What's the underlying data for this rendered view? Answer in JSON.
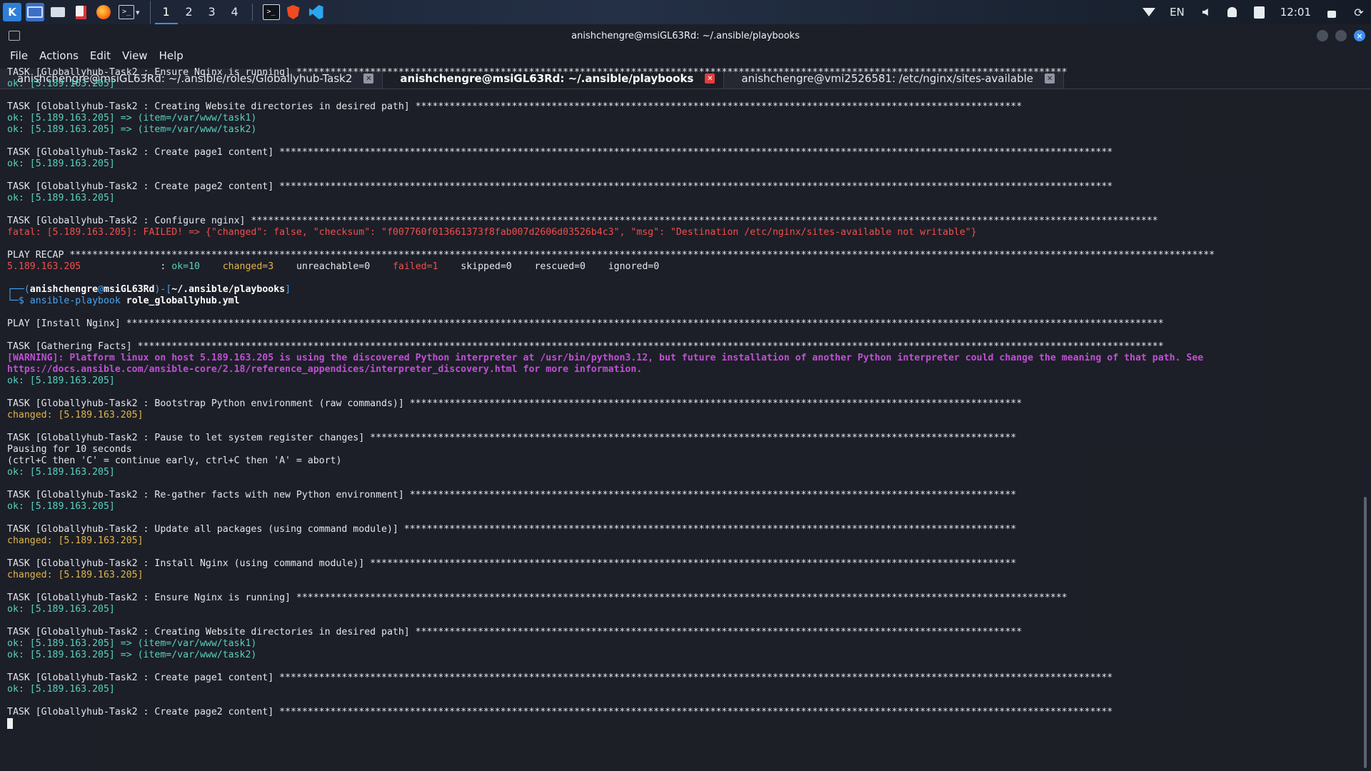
{
  "panel": {
    "launcher_label": "K",
    "term_icon_label": ">_",
    "workspaces": [
      "1",
      "2",
      "3",
      "4"
    ],
    "active_workspace": "1",
    "language": "EN",
    "clock": "12:01"
  },
  "window": {
    "title": "anishchengre@msiGL63Rd: ~/.ansible/playbooks",
    "close_glyph": "×"
  },
  "menu": [
    "File",
    "Actions",
    "Edit",
    "View",
    "Help"
  ],
  "tabs": [
    {
      "label": "anishchengre@msiGL63Rd: ~/.ansible/roles/Globallyhub-Task2",
      "active": false
    },
    {
      "label": "anishchengre@msiGL63Rd: ~/.ansible/playbooks",
      "active": true
    },
    {
      "label": "anishchengre@vmi2526581: /etc/nginx/sites-available",
      "active": false
    }
  ],
  "terminal": {
    "lines": [
      {
        "type": "task",
        "text": "TASK [Globallyhub-Task2 : Ensure Nginx is running] ****************************************************************************************************************************************"
      },
      {
        "type": "ok",
        "text": "ok: [5.189.163.205]"
      },
      {
        "type": "blank",
        "text": ""
      },
      {
        "type": "task",
        "text": "TASK [Globallyhub-Task2 : Creating Website directories in desired path] ***********************************************************************************************************"
      },
      {
        "type": "ok",
        "text": "ok: [5.189.163.205] => (item=/var/www/task1)"
      },
      {
        "type": "ok",
        "text": "ok: [5.189.163.205] => (item=/var/www/task2)"
      },
      {
        "type": "blank",
        "text": ""
      },
      {
        "type": "task",
        "text": "TASK [Globallyhub-Task2 : Create page1 content] ***************************************************************************************************************************************************"
      },
      {
        "type": "ok",
        "text": "ok: [5.189.163.205]"
      },
      {
        "type": "blank",
        "text": ""
      },
      {
        "type": "task",
        "text": "TASK [Globallyhub-Task2 : Create page2 content] ***************************************************************************************************************************************************"
      },
      {
        "type": "ok",
        "text": "ok: [5.189.163.205]"
      },
      {
        "type": "blank",
        "text": ""
      },
      {
        "type": "task",
        "text": "TASK [Globallyhub-Task2 : Configure nginx] ****************************************************************************************************************************************************************"
      },
      {
        "type": "fatal",
        "text": "fatal: [5.189.163.205]: FAILED! => {\"changed\": false, \"checksum\": \"f007760f013661373f8fab007d2606d03526b4c3\", \"msg\": \"Destination /etc/nginx/sites-available not writable\"}"
      },
      {
        "type": "blank",
        "text": ""
      },
      {
        "type": "task",
        "text": "PLAY RECAP **********************************************************************************************************************************************************************************************************"
      },
      {
        "type": "recap",
        "host": "5.189.163.205",
        "pad": "              : ",
        "ok": "ok=10",
        "changed": "changed=3",
        "unreachable": "unreachable=0",
        "failed": "failed=1",
        "skipped": "skipped=0",
        "rescued": "rescued=0",
        "ignored": "ignored=0"
      },
      {
        "type": "blank",
        "text": ""
      },
      {
        "type": "prompt1",
        "user": "anishchengre",
        "at": "@",
        "host": "msiGL63Rd",
        "path": "~/.ansible/playbooks"
      },
      {
        "type": "prompt2",
        "cmd": "ansible-playbook",
        "arg": "role_globallyhub.yml"
      },
      {
        "type": "blank",
        "text": ""
      },
      {
        "type": "task",
        "text": "PLAY [Install Nginx] ***************************************************************************************************************************************************************************************"
      },
      {
        "type": "blank",
        "text": ""
      },
      {
        "type": "task",
        "text": "TASK [Gathering Facts] *************************************************************************************************************************************************************************************"
      },
      {
        "type": "warn",
        "text": "[WARNING]: Platform linux on host 5.189.163.205 is using the discovered Python interpreter at /usr/bin/python3.12, but future installation of another Python interpreter could change the meaning of that path. See"
      },
      {
        "type": "warn",
        "text": "https://docs.ansible.com/ansible-core/2.18/reference_appendices/interpreter_discovery.html for more information."
      },
      {
        "type": "ok",
        "text": "ok: [5.189.163.205]"
      },
      {
        "type": "blank",
        "text": ""
      },
      {
        "type": "task",
        "text": "TASK [Globallyhub-Task2 : Bootstrap Python environment (raw commands)] ************************************************************************************************************"
      },
      {
        "type": "changed",
        "text": "changed: [5.189.163.205]"
      },
      {
        "type": "blank",
        "text": ""
      },
      {
        "type": "task",
        "text": "TASK [Globallyhub-Task2 : Pause to let system register changes] ******************************************************************************************************************"
      },
      {
        "type": "plain",
        "text": "Pausing for 10 seconds"
      },
      {
        "type": "plain",
        "text": "(ctrl+C then 'C' = continue early, ctrl+C then 'A' = abort)"
      },
      {
        "type": "ok",
        "text": "ok: [5.189.163.205]"
      },
      {
        "type": "blank",
        "text": ""
      },
      {
        "type": "task",
        "text": "TASK [Globallyhub-Task2 : Re-gather facts with new Python environment] ***********************************************************************************************************"
      },
      {
        "type": "ok",
        "text": "ok: [5.189.163.205]"
      },
      {
        "type": "blank",
        "text": ""
      },
      {
        "type": "task",
        "text": "TASK [Globallyhub-Task2 : Update all packages (using command module)] ************************************************************************************************************"
      },
      {
        "type": "changed",
        "text": "changed: [5.189.163.205]"
      },
      {
        "type": "blank",
        "text": ""
      },
      {
        "type": "task",
        "text": "TASK [Globallyhub-Task2 : Install Nginx (using command module)] ******************************************************************************************************************"
      },
      {
        "type": "changed",
        "text": "changed: [5.189.163.205]"
      },
      {
        "type": "blank",
        "text": ""
      },
      {
        "type": "task",
        "text": "TASK [Globallyhub-Task2 : Ensure Nginx is running] ****************************************************************************************************************************************"
      },
      {
        "type": "ok",
        "text": "ok: [5.189.163.205]"
      },
      {
        "type": "blank",
        "text": ""
      },
      {
        "type": "task",
        "text": "TASK [Globallyhub-Task2 : Creating Website directories in desired path] ***********************************************************************************************************"
      },
      {
        "type": "ok",
        "text": "ok: [5.189.163.205] => (item=/var/www/task1)"
      },
      {
        "type": "ok",
        "text": "ok: [5.189.163.205] => (item=/var/www/task2)"
      },
      {
        "type": "blank",
        "text": ""
      },
      {
        "type": "task",
        "text": "TASK [Globallyhub-Task2 : Create page1 content] ***************************************************************************************************************************************************"
      },
      {
        "type": "ok",
        "text": "ok: [5.189.163.205]"
      },
      {
        "type": "blank",
        "text": ""
      },
      {
        "type": "task",
        "text": "TASK [Globallyhub-Task2 : Create page2 content] ***************************************************************************************************************************************************"
      },
      {
        "type": "cursor",
        "text": ""
      }
    ]
  },
  "colors": {
    "ok": "#59d0c0",
    "fatal": "#f24d4d",
    "changed": "#e3b54a",
    "warning": "#c14fd6",
    "prompt": "#4aa3f0",
    "accent": "#3d8ef0"
  }
}
